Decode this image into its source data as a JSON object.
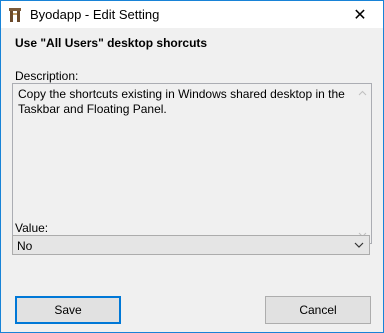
{
  "window": {
    "title": "Byodapp - Edit Setting",
    "close_glyph": "✕"
  },
  "setting": {
    "heading": "Use \"All Users\" desktop shorcuts",
    "description_label": "Description:",
    "description_text": "Copy the shortcuts existing in Windows shared desktop in the Taskbar and Floating Panel.",
    "value_label": "Value:",
    "value_selected": "No"
  },
  "buttons": {
    "save_label": "Save",
    "cancel_label": "Cancel"
  },
  "colors": {
    "window_border": "#1883d7",
    "focus_accent": "#0078d7"
  }
}
